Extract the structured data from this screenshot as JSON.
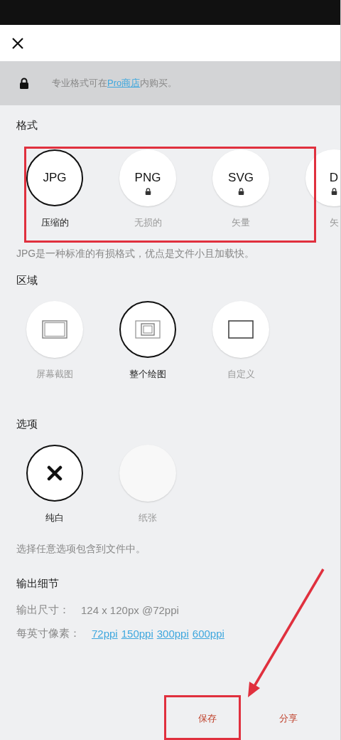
{
  "banner": {
    "text_before": "专业格式可在",
    "link": "Pro商店",
    "text_after": "内购买。"
  },
  "format": {
    "title": "格式",
    "items": [
      {
        "name": "JPG",
        "label": "压缩的",
        "locked": false,
        "selected": true
      },
      {
        "name": "PNG",
        "label": "无损的",
        "locked": true,
        "selected": false
      },
      {
        "name": "SVG",
        "label": "矢量",
        "locked": true,
        "selected": false
      },
      {
        "name": "D",
        "label": "矢",
        "locked": true,
        "selected": false
      }
    ],
    "description": "JPG是一种标准的有损格式，优点是文件小且加载快。"
  },
  "area": {
    "title": "区域",
    "items": [
      {
        "kind": "screen",
        "label": "屏幕截图",
        "selected": false
      },
      {
        "kind": "drawing",
        "label": "整个绘图",
        "selected": true
      },
      {
        "kind": "custom",
        "label": "自定义",
        "selected": false
      }
    ]
  },
  "options": {
    "title": "选项",
    "items": [
      {
        "kind": "none",
        "label": "纯白",
        "selected": true
      },
      {
        "kind": "paper",
        "label": "纸张",
        "selected": false
      }
    ],
    "description": "选择任意选项包含到文件中。"
  },
  "output": {
    "title": "输出细节",
    "size_label": "输出尺寸：",
    "size_value": "124 x 120px @72ppi",
    "ppi_label": "每英寸像素：",
    "ppi_options": [
      "72ppi",
      "150ppi",
      "300ppi",
      "600ppi"
    ]
  },
  "actions": [
    {
      "label": "保存"
    },
    {
      "label": "分享"
    }
  ]
}
